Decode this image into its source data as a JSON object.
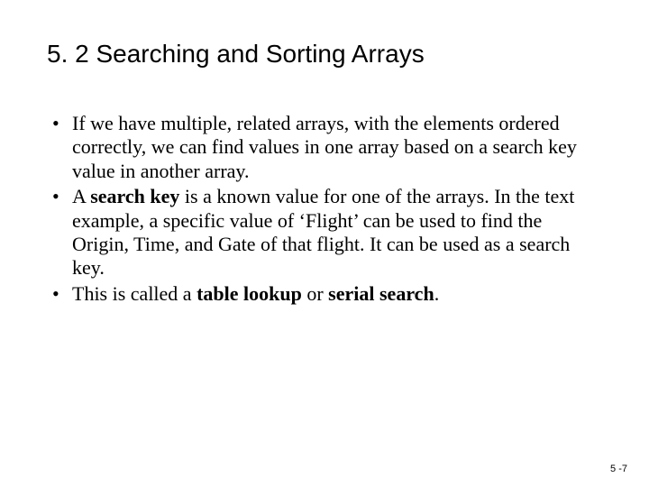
{
  "title": "5. 2 Searching and Sorting Arrays",
  "bullets": {
    "b1": "If we have multiple, related arrays, with the elements ordered correctly, we can find values in one array based on a search key value in another array.",
    "b2_part1": "A ",
    "b2_bold1": "search key",
    "b2_part2": " is a known value for one of the arrays. In the text example, a specific value of ‘Flight’ can be used to find the Origin, Time, and Gate of that flight. It can be used as a search key.",
    "b3_part1": "This is called a ",
    "b3_bold1": "table lookup",
    "b3_part2": " or ",
    "b3_bold2": "serial search",
    "b3_part3": "."
  },
  "page_number": "5 -7"
}
